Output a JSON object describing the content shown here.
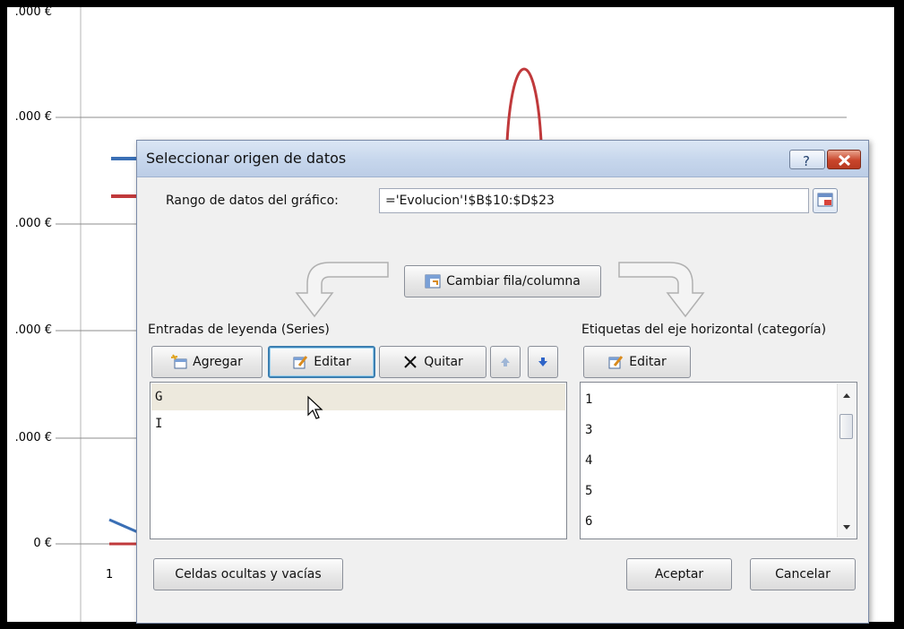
{
  "chart": {
    "y_labels": [
      ".000 €",
      ".000 €",
      ".000 €",
      ".000 €",
      ".000 €",
      "0 €"
    ],
    "x_tick": "1",
    "series_colors": [
      "#3a6fb5",
      "#c0393b"
    ]
  },
  "dialog": {
    "title": "Seleccionar origen de datos",
    "range_label": "Rango de datos del gráfico:",
    "range_value": "='Evolucion'!$B$10:$D$23",
    "switch_button": "Cambiar fila/columna",
    "legend_section_label": "Entradas de leyenda (Series)",
    "axis_section_label": "Etiquetas del eje horizontal (categoría)",
    "legend_toolbar": {
      "add": "Agregar",
      "edit": "Editar",
      "remove": "Quitar"
    },
    "axis_toolbar": {
      "edit": "Editar"
    },
    "series": [
      "G",
      "I"
    ],
    "categories": [
      "1",
      "3",
      "4",
      "5",
      "6"
    ],
    "hidden_cells_button": "Celdas ocultas y vacías",
    "ok_button": "Aceptar",
    "cancel_button": "Cancelar"
  }
}
